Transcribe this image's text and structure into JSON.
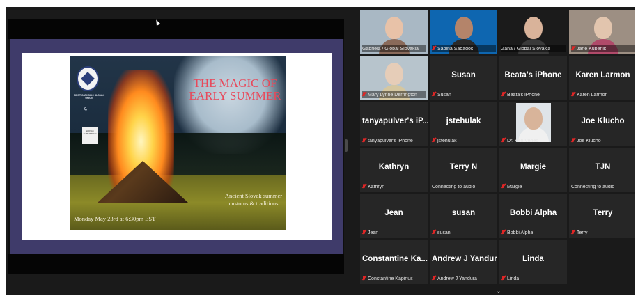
{
  "poster": {
    "title": "THE MAGIC OF EARLY SUMMER",
    "subtitle": "Ancient Slovak summer customs & traditions",
    "date": "Monday May 23rd at 6:30pm EST",
    "logo_text": "FIRST CATHOLIC SLOVAK UNION",
    "ampersand": "&",
    "badge_text": "SLOVAK SUMMER GO"
  },
  "gallery": {
    "video_tiles": [
      {
        "label": "Gabriela / Global Slovakia",
        "muted": false,
        "bg": "#a9b8c4",
        "face": "#e8c2a8",
        "body": "#8a6a5a"
      },
      {
        "label": "Sabina Sabados",
        "muted": true,
        "bg": "#0e66b0",
        "face": "#b4846a",
        "body": "#2a2a2a"
      },
      {
        "label": "Zana / Global Slovakia",
        "muted": false,
        "bg": "#1b1b1b",
        "face": "#d9b39a",
        "body": "#3a3a3a",
        "active": true
      },
      {
        "label": "Jane Kubenik",
        "muted": true,
        "bg": "#9d8f83",
        "face": "#e2c5ae",
        "body": "#b04a6a"
      },
      {
        "label": "Mary Lynne Derrington",
        "muted": true,
        "bg": "#b7c4cc",
        "face": "#e6cdb8",
        "body": "#d5c7a0"
      }
    ],
    "name_tiles": [
      {
        "name": "Susan",
        "label": "Susan",
        "muted": true
      },
      {
        "name": "Beata's iPhone",
        "label": "Beata's iPhone",
        "muted": true
      },
      {
        "name": "Karen Larmon",
        "label": "Karen Larmon",
        "muted": true
      },
      {
        "name": "tanyapulver's iP...",
        "label": "tanyapulver's iPhone",
        "muted": true
      },
      {
        "name": "jstehulak",
        "label": "jstehulak",
        "muted": true
      },
      {
        "name": "Dr. Ken Vehec",
        "label": "Dr. Ken Vehec",
        "muted": true
      },
      {
        "name": "Joe Klucho",
        "label": "Joe Klucho",
        "muted": true
      },
      {
        "name": "Kathryn",
        "label": "Kathryn",
        "muted": true
      },
      {
        "name": "Terry N",
        "label": "Connecting to audio",
        "muted": false
      },
      {
        "name": "Margie",
        "label": "Margie",
        "muted": true
      },
      {
        "name": "TJN",
        "label": "Connecting to audio",
        "muted": false
      },
      {
        "name": "Jean",
        "label": "Jean",
        "muted": true
      },
      {
        "name": "susan",
        "label": "susan",
        "muted": true
      },
      {
        "name": "Bobbi Alpha",
        "label": "Bobbi Alpha",
        "muted": true
      },
      {
        "name": "Terry",
        "label": "Terry",
        "muted": true
      },
      {
        "name": "Constantine Ka...",
        "label": "Constantine Kapinus",
        "muted": true
      },
      {
        "name": "Andrew J Yandura",
        "label": "Andrew J Yandura",
        "muted": true
      },
      {
        "name": "Linda",
        "label": "Linda",
        "muted": true
      }
    ],
    "photo_tile": {
      "label": "Dr. Ken Vehec",
      "muted": true
    }
  },
  "icons": {
    "chevron": "chevron-down-icon",
    "muted_mic": "mic-off-icon"
  },
  "colors": {
    "active_speaker": "#9bd65a",
    "muted": "#e02626",
    "tile_bg": "#262626"
  }
}
